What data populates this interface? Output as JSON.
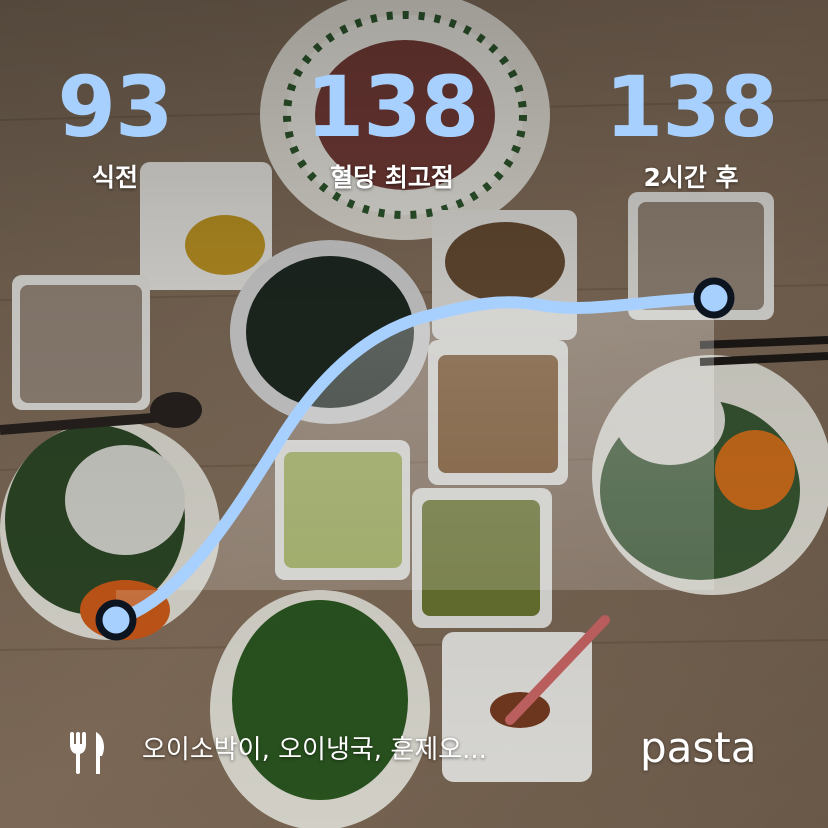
{
  "stats": {
    "before": {
      "value": "93",
      "label": "식전"
    },
    "peak": {
      "value": "138",
      "label": "혈당 최고점"
    },
    "after": {
      "value": "138",
      "label": "2시간 후"
    }
  },
  "footer": {
    "food_icon": "fork-knife-icon",
    "meal": "오이소박이, 오이냉국, 훈제오...",
    "brand": "pasta"
  },
  "colors": {
    "accent": "#a8d0ff",
    "curve_outline": "#0c1420",
    "text": "#ffffff"
  }
}
